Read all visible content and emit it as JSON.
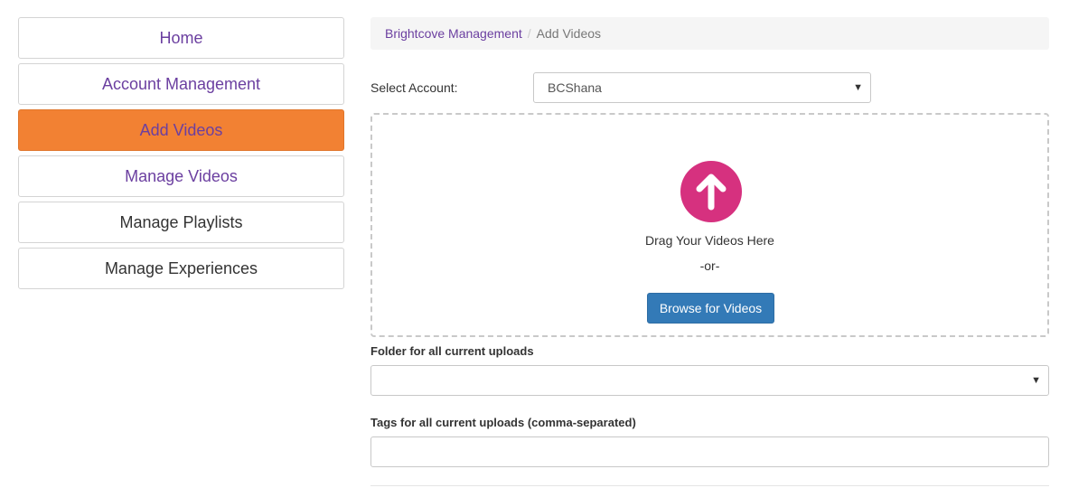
{
  "sidebar": {
    "items": [
      {
        "label": "Home"
      },
      {
        "label": "Account Management"
      },
      {
        "label": "Add Videos"
      },
      {
        "label": "Manage Videos"
      },
      {
        "label": "Manage Playlists"
      },
      {
        "label": "Manage Experiences"
      }
    ],
    "active_item": "Add Videos"
  },
  "breadcrumb": {
    "parent": "Brightcove Management",
    "separator": "/",
    "current": "Add Videos"
  },
  "account": {
    "label": "Select Account:",
    "selected": "BCShana"
  },
  "dropzone": {
    "icon": "upload-arrow-icon",
    "drag_text": "Drag Your Videos Here",
    "or_text": "-or-",
    "browse_label": "Browse for Videos"
  },
  "folder": {
    "label": "Folder for all current uploads",
    "selected": ""
  },
  "tags": {
    "label": "Tags for all current uploads (comma-separated)",
    "value": ""
  },
  "colors": {
    "accent_purple": "#6b3fa0",
    "active_orange": "#f28133",
    "upload_pink": "#d6317f",
    "button_blue": "#337ab7"
  }
}
